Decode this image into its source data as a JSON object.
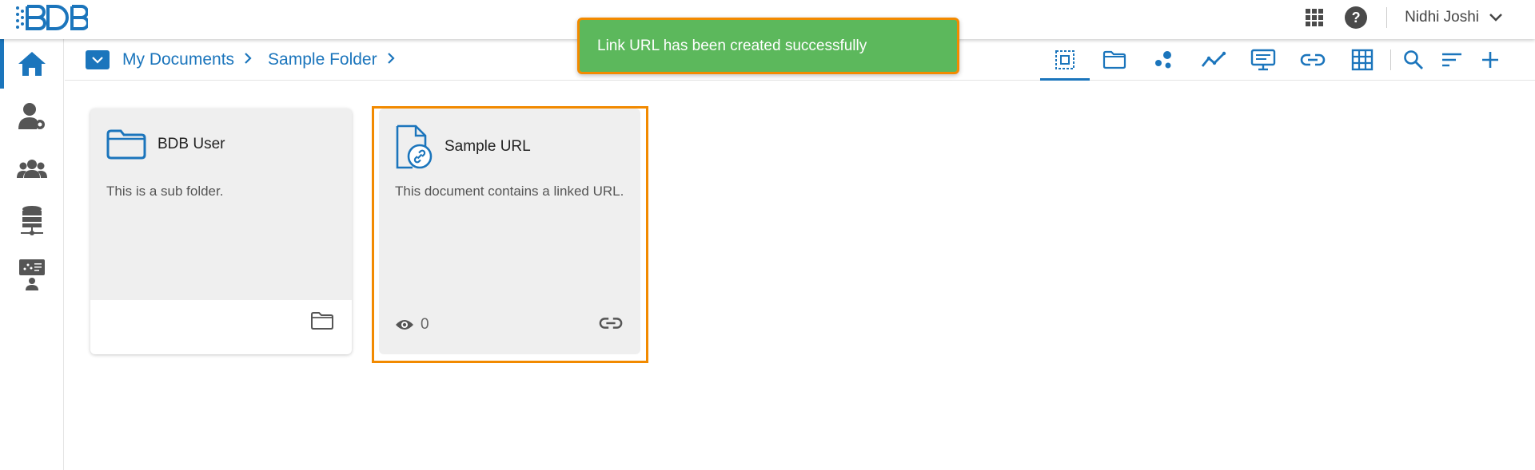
{
  "header": {
    "user_name": "Nidhi Joshi",
    "help_label": "?"
  },
  "toast": {
    "message": "Link URL has been created successfully",
    "bg_color": "#5cb85c"
  },
  "breadcrumb": {
    "items": [
      "My Documents",
      "Sample Folder"
    ],
    "separator": ">"
  },
  "sidebar": {
    "items": [
      {
        "icon": "home-icon",
        "active": true
      },
      {
        "icon": "user-settings-icon",
        "active": false
      },
      {
        "icon": "users-group-icon",
        "active": false
      },
      {
        "icon": "database-icon",
        "active": false
      },
      {
        "icon": "presentation-user-icon",
        "active": false
      }
    ]
  },
  "toolbar": {
    "tools": [
      "select-all-icon",
      "folder-icon",
      "scatter-icon",
      "line-chart-icon",
      "presentation-icon",
      "link-icon",
      "grid-icon",
      "search-icon",
      "sort-icon",
      "add-icon"
    ]
  },
  "cards": [
    {
      "title": "BDB User",
      "description": "This is a sub folder.",
      "icon": "folder-icon",
      "footer_icon": "folder-icon"
    },
    {
      "title": "Sample URL",
      "description": "This document contains a linked URL.",
      "icon": "link-document-icon",
      "view_count": "0",
      "footer_icon": "link-icon",
      "selected": true
    }
  ],
  "colors": {
    "accent": "#1b75bc",
    "selection": "#f28a00",
    "toast": "#5cb85c"
  }
}
